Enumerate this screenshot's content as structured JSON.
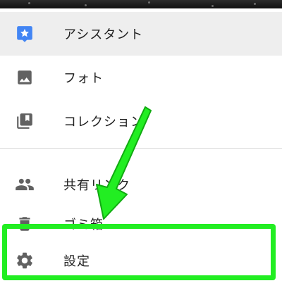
{
  "menu": {
    "items": [
      {
        "label": "アシスタント",
        "icon": "assistant-icon",
        "selected": true
      },
      {
        "label": "フォト",
        "icon": "photo-icon",
        "selected": false
      },
      {
        "label": "コレクション",
        "icon": "collections-icon",
        "selected": false
      },
      {
        "label": "共有リンク",
        "icon": "people-icon",
        "selected": false
      },
      {
        "label": "ゴミ箱",
        "icon": "trash-icon",
        "selected": false
      },
      {
        "label": "設定",
        "icon": "gear-icon",
        "selected": false
      }
    ]
  },
  "colors": {
    "assistant_icon": "#4285f4",
    "icon_gray": "#616161",
    "highlight": "#22ee22",
    "selected_bg": "#eeeeee"
  }
}
